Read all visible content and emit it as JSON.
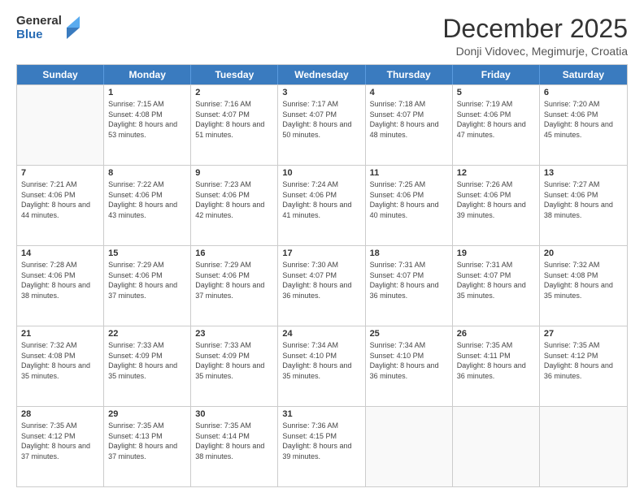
{
  "logo": {
    "general": "General",
    "blue": "Blue"
  },
  "title": "December 2025",
  "subtitle": "Donji Vidovec, Megimurje, Croatia",
  "header_days": [
    "Sunday",
    "Monday",
    "Tuesday",
    "Wednesday",
    "Thursday",
    "Friday",
    "Saturday"
  ],
  "weeks": [
    [
      {
        "day": "",
        "sunrise": "",
        "sunset": "",
        "daylight": ""
      },
      {
        "day": "1",
        "sunrise": "Sunrise: 7:15 AM",
        "sunset": "Sunset: 4:08 PM",
        "daylight": "Daylight: 8 hours and 53 minutes."
      },
      {
        "day": "2",
        "sunrise": "Sunrise: 7:16 AM",
        "sunset": "Sunset: 4:07 PM",
        "daylight": "Daylight: 8 hours and 51 minutes."
      },
      {
        "day": "3",
        "sunrise": "Sunrise: 7:17 AM",
        "sunset": "Sunset: 4:07 PM",
        "daylight": "Daylight: 8 hours and 50 minutes."
      },
      {
        "day": "4",
        "sunrise": "Sunrise: 7:18 AM",
        "sunset": "Sunset: 4:07 PM",
        "daylight": "Daylight: 8 hours and 48 minutes."
      },
      {
        "day": "5",
        "sunrise": "Sunrise: 7:19 AM",
        "sunset": "Sunset: 4:06 PM",
        "daylight": "Daylight: 8 hours and 47 minutes."
      },
      {
        "day": "6",
        "sunrise": "Sunrise: 7:20 AM",
        "sunset": "Sunset: 4:06 PM",
        "daylight": "Daylight: 8 hours and 45 minutes."
      }
    ],
    [
      {
        "day": "7",
        "sunrise": "Sunrise: 7:21 AM",
        "sunset": "Sunset: 4:06 PM",
        "daylight": "Daylight: 8 hours and 44 minutes."
      },
      {
        "day": "8",
        "sunrise": "Sunrise: 7:22 AM",
        "sunset": "Sunset: 4:06 PM",
        "daylight": "Daylight: 8 hours and 43 minutes."
      },
      {
        "day": "9",
        "sunrise": "Sunrise: 7:23 AM",
        "sunset": "Sunset: 4:06 PM",
        "daylight": "Daylight: 8 hours and 42 minutes."
      },
      {
        "day": "10",
        "sunrise": "Sunrise: 7:24 AM",
        "sunset": "Sunset: 4:06 PM",
        "daylight": "Daylight: 8 hours and 41 minutes."
      },
      {
        "day": "11",
        "sunrise": "Sunrise: 7:25 AM",
        "sunset": "Sunset: 4:06 PM",
        "daylight": "Daylight: 8 hours and 40 minutes."
      },
      {
        "day": "12",
        "sunrise": "Sunrise: 7:26 AM",
        "sunset": "Sunset: 4:06 PM",
        "daylight": "Daylight: 8 hours and 39 minutes."
      },
      {
        "day": "13",
        "sunrise": "Sunrise: 7:27 AM",
        "sunset": "Sunset: 4:06 PM",
        "daylight": "Daylight: 8 hours and 38 minutes."
      }
    ],
    [
      {
        "day": "14",
        "sunrise": "Sunrise: 7:28 AM",
        "sunset": "Sunset: 4:06 PM",
        "daylight": "Daylight: 8 hours and 38 minutes."
      },
      {
        "day": "15",
        "sunrise": "Sunrise: 7:29 AM",
        "sunset": "Sunset: 4:06 PM",
        "daylight": "Daylight: 8 hours and 37 minutes."
      },
      {
        "day": "16",
        "sunrise": "Sunrise: 7:29 AM",
        "sunset": "Sunset: 4:06 PM",
        "daylight": "Daylight: 8 hours and 37 minutes."
      },
      {
        "day": "17",
        "sunrise": "Sunrise: 7:30 AM",
        "sunset": "Sunset: 4:07 PM",
        "daylight": "Daylight: 8 hours and 36 minutes."
      },
      {
        "day": "18",
        "sunrise": "Sunrise: 7:31 AM",
        "sunset": "Sunset: 4:07 PM",
        "daylight": "Daylight: 8 hours and 36 minutes."
      },
      {
        "day": "19",
        "sunrise": "Sunrise: 7:31 AM",
        "sunset": "Sunset: 4:07 PM",
        "daylight": "Daylight: 8 hours and 35 minutes."
      },
      {
        "day": "20",
        "sunrise": "Sunrise: 7:32 AM",
        "sunset": "Sunset: 4:08 PM",
        "daylight": "Daylight: 8 hours and 35 minutes."
      }
    ],
    [
      {
        "day": "21",
        "sunrise": "Sunrise: 7:32 AM",
        "sunset": "Sunset: 4:08 PM",
        "daylight": "Daylight: 8 hours and 35 minutes."
      },
      {
        "day": "22",
        "sunrise": "Sunrise: 7:33 AM",
        "sunset": "Sunset: 4:09 PM",
        "daylight": "Daylight: 8 hours and 35 minutes."
      },
      {
        "day": "23",
        "sunrise": "Sunrise: 7:33 AM",
        "sunset": "Sunset: 4:09 PM",
        "daylight": "Daylight: 8 hours and 35 minutes."
      },
      {
        "day": "24",
        "sunrise": "Sunrise: 7:34 AM",
        "sunset": "Sunset: 4:10 PM",
        "daylight": "Daylight: 8 hours and 35 minutes."
      },
      {
        "day": "25",
        "sunrise": "Sunrise: 7:34 AM",
        "sunset": "Sunset: 4:10 PM",
        "daylight": "Daylight: 8 hours and 36 minutes."
      },
      {
        "day": "26",
        "sunrise": "Sunrise: 7:35 AM",
        "sunset": "Sunset: 4:11 PM",
        "daylight": "Daylight: 8 hours and 36 minutes."
      },
      {
        "day": "27",
        "sunrise": "Sunrise: 7:35 AM",
        "sunset": "Sunset: 4:12 PM",
        "daylight": "Daylight: 8 hours and 36 minutes."
      }
    ],
    [
      {
        "day": "28",
        "sunrise": "Sunrise: 7:35 AM",
        "sunset": "Sunset: 4:12 PM",
        "daylight": "Daylight: 8 hours and 37 minutes."
      },
      {
        "day": "29",
        "sunrise": "Sunrise: 7:35 AM",
        "sunset": "Sunset: 4:13 PM",
        "daylight": "Daylight: 8 hours and 37 minutes."
      },
      {
        "day": "30",
        "sunrise": "Sunrise: 7:35 AM",
        "sunset": "Sunset: 4:14 PM",
        "daylight": "Daylight: 8 hours and 38 minutes."
      },
      {
        "day": "31",
        "sunrise": "Sunrise: 7:36 AM",
        "sunset": "Sunset: 4:15 PM",
        "daylight": "Daylight: 8 hours and 39 minutes."
      },
      {
        "day": "",
        "sunrise": "",
        "sunset": "",
        "daylight": ""
      },
      {
        "day": "",
        "sunrise": "",
        "sunset": "",
        "daylight": ""
      },
      {
        "day": "",
        "sunrise": "",
        "sunset": "",
        "daylight": ""
      }
    ]
  ]
}
